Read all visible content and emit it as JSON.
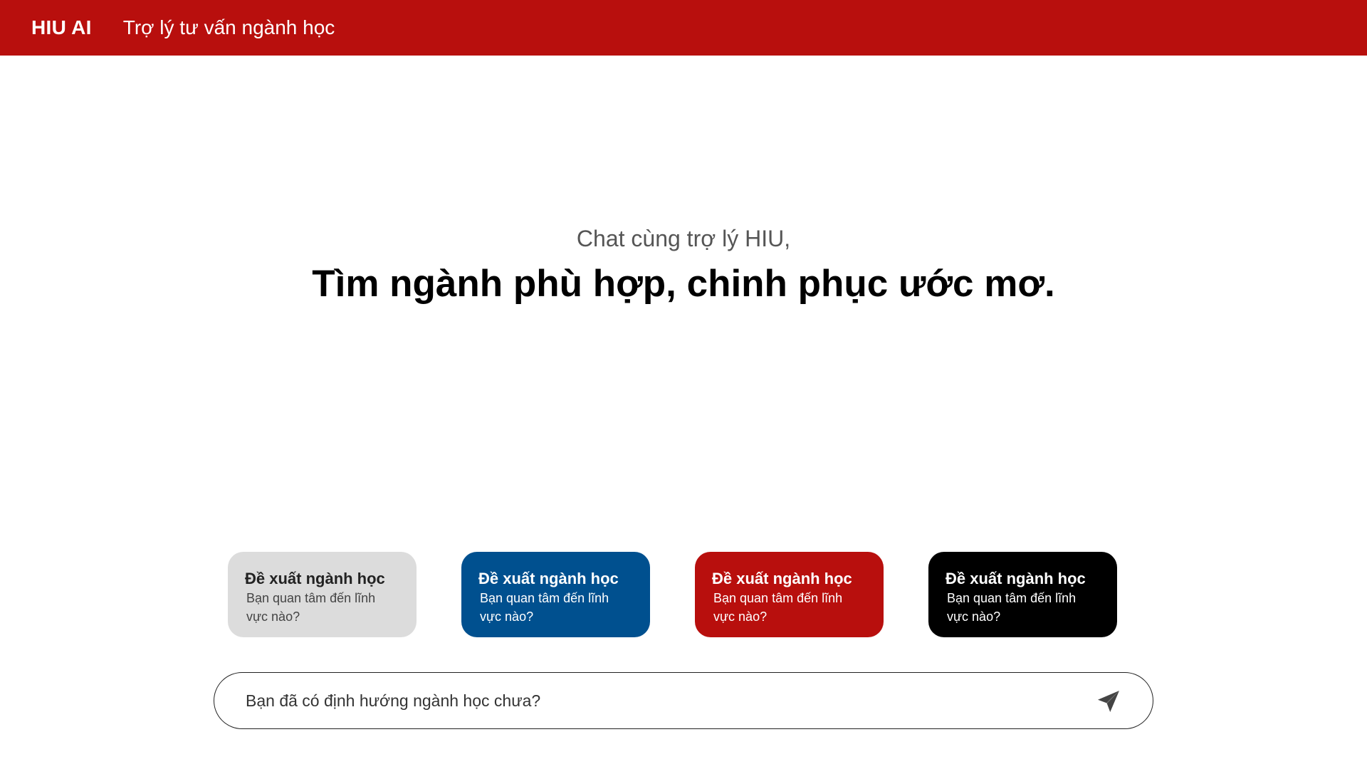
{
  "header": {
    "brand": "HIU AI",
    "nav_title": "Trợ lý tư vấn ngành học"
  },
  "hero": {
    "greeting": "Chat cùng trợ lý HIU,",
    "title": "Tìm ngành phù hợp, chinh phục ước mơ."
  },
  "suggestions": [
    {
      "title": "Đề xuất ngành học",
      "description": "Bạn quan tâm đến lĩnh vực nào?",
      "color": "#dcdcdc"
    },
    {
      "title": "Đề xuất ngành học",
      "description": "Bạn quan tâm đến lĩnh vực nào?",
      "color": "#00508f"
    },
    {
      "title": "Đề xuất ngành học",
      "description": "Bạn quan tâm đến lĩnh vực nào?",
      "color": "#b80f0d"
    },
    {
      "title": "Đề xuất ngành học",
      "description": "Bạn quan tâm đến lĩnh vực nào?",
      "color": "#000000"
    }
  ],
  "chat": {
    "placeholder": "Bạn đã có định hướng ngành học chưa?",
    "send_icon": "send-icon"
  },
  "colors": {
    "brand_red": "#b80f0d",
    "blue": "#00508f"
  }
}
